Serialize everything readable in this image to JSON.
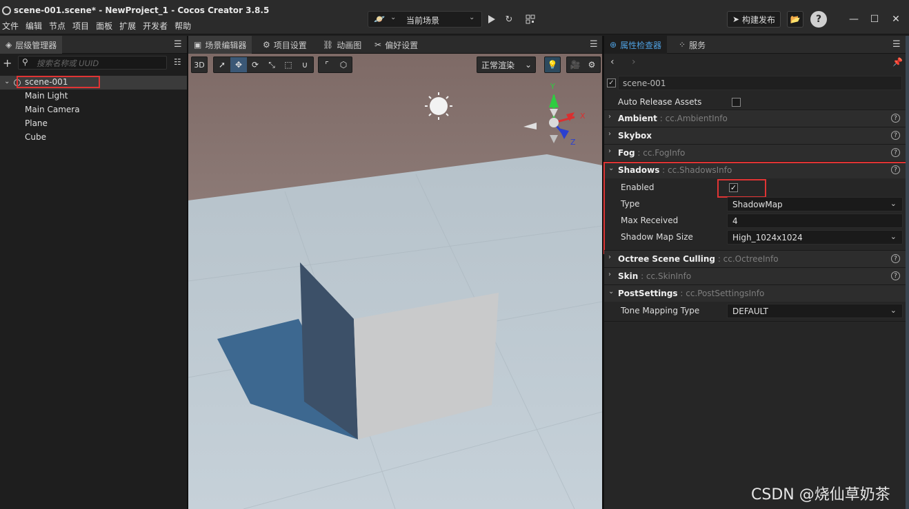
{
  "window": {
    "title": "scene-001.scene* - NewProject_1 - Cocos Creator 3.8.5",
    "menu": [
      "文件",
      "编辑",
      "节点",
      "项目",
      "面板",
      "扩展",
      "开发者",
      "帮助"
    ],
    "scene_selector": "当前场景",
    "publish_label": "构建发布",
    "help_label": "?"
  },
  "hierarchy": {
    "tab_label": "层级管理器",
    "search_placeholder": "搜索名称或 UUID",
    "root": "scene-001",
    "children": [
      "Main Light",
      "Main Camera",
      "Plane",
      "Cube"
    ]
  },
  "editor_tabs": [
    "场景编辑器",
    "项目设置",
    "动画图",
    "偏好设置"
  ],
  "scene_toolbar": {
    "mode_3d": "3D",
    "render_mode": "正常渲染",
    "gizmo_axes": {
      "x": "X",
      "y": "Y",
      "z": "Z"
    }
  },
  "inspector": {
    "tabs": [
      "属性检查器",
      "服务"
    ],
    "node_name": "scene-001",
    "auto_release_label": "Auto Release Assets",
    "auto_release_checked": false,
    "sections": [
      {
        "name": "Ambient",
        "type": "cc.AmbientInfo",
        "expanded": false
      },
      {
        "name": "Skybox",
        "type": "",
        "expanded": false
      },
      {
        "name": "Fog",
        "type": "cc.FogInfo",
        "expanded": false
      },
      {
        "name": "Shadows",
        "type": "cc.ShadowsInfo",
        "expanded": true
      },
      {
        "name": "Octree Scene Culling",
        "type": "cc.OctreeInfo",
        "expanded": false
      },
      {
        "name": "Skin",
        "type": "cc.SkinInfo",
        "expanded": false
      },
      {
        "name": "PostSettings",
        "type": "cc.PostSettingsInfo",
        "expanded": true
      }
    ],
    "shadows": {
      "enabled_label": "Enabled",
      "enabled": true,
      "type_label": "Type",
      "type_value": "ShadowMap",
      "max_received_label": "Max Received",
      "max_received_value": "4",
      "map_size_label": "Shadow Map Size",
      "map_size_value": "High_1024x1024"
    },
    "post_settings": {
      "tone_mapping_label": "Tone Mapping Type",
      "tone_mapping_value": "DEFAULT"
    }
  },
  "watermark": "CSDN @烧仙草奶茶",
  "colors": {
    "highlight_red": "#e03434",
    "accent_blue": "#4fa0e0"
  }
}
